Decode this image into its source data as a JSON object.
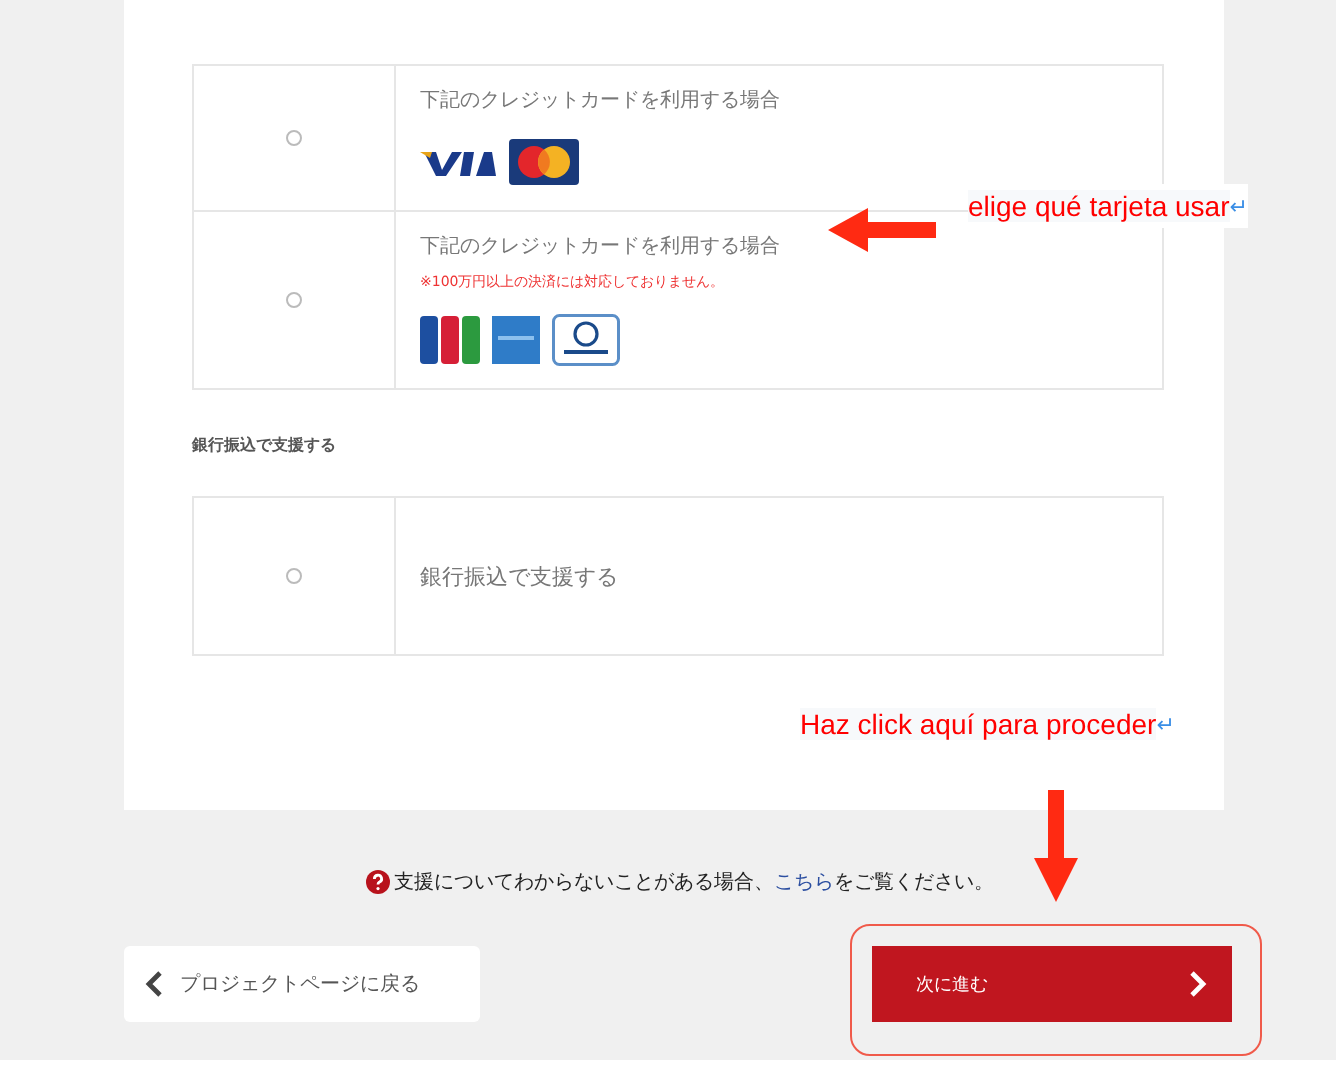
{
  "payment_options": [
    {
      "selected": false,
      "title": "下記のクレジットカードを利用する場合",
      "logos": [
        {
          "kind": "visa"
        },
        {
          "kind": "mastercard"
        }
      ]
    },
    {
      "selected": false,
      "title": "下記のクレジットカードを利用する場合",
      "note": "※100万円以上の決済には対応しておりません。",
      "logos": [
        {
          "kind": "jcb"
        },
        {
          "kind": "amex"
        },
        {
          "kind": "diners"
        }
      ]
    }
  ],
  "bank_section": {
    "heading": "銀行振込で支援する",
    "options": [
      {
        "selected": false,
        "title": "銀行振込で支援する"
      }
    ]
  },
  "help": {
    "before": "支援についてわからないことがある場合、",
    "link": "こちら",
    "after": "をご覧ください。"
  },
  "buttons": {
    "back": "プロジェクトページに戻る",
    "next": "次に進む"
  },
  "annotations": [
    {
      "text": "elige qué tarjeta usar",
      "mark": "↵"
    },
    {
      "text": "Haz click aquí para proceder",
      "mark": "↵"
    }
  ]
}
